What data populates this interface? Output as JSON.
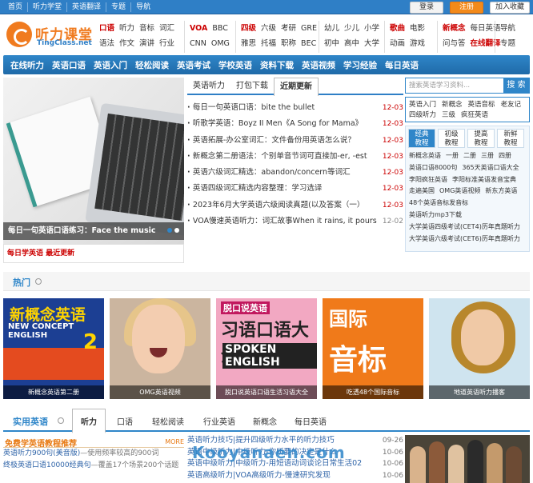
{
  "topbar": {
    "links": [
      "首页",
      "听力学堂",
      "英语翻译",
      "专题",
      "导航"
    ],
    "login": "登录",
    "register": "注册",
    "favorite": "加入收藏"
  },
  "logo": {
    "name": "听力课堂",
    "domain": "TingClass.net"
  },
  "quick": [
    {
      "rows": [
        [
          "口语",
          "听力",
          "音标",
          "词汇"
        ],
        [
          "语法",
          "作文",
          "演讲",
          "行业"
        ]
      ],
      "hl": [
        "口语"
      ]
    },
    {
      "rows": [
        [
          "VOA",
          "BBC"
        ],
        [
          "CNN",
          "OMG"
        ]
      ],
      "hl": [
        "VOA"
      ]
    },
    {
      "rows": [
        [
          "四级",
          "六级",
          "考研",
          "GRE"
        ],
        [
          "雅思",
          "托福",
          "职称",
          "BEC"
        ]
      ],
      "hl": [
        "四级"
      ]
    },
    {
      "rows": [
        [
          "幼儿",
          "少儿",
          "小学"
        ],
        [
          "初中",
          "高中",
          "大学"
        ]
      ],
      "hl": []
    },
    {
      "rows": [
        [
          "歌曲",
          "电影"
        ],
        [
          "动画",
          "游戏"
        ]
      ],
      "hl": [
        "歌曲"
      ]
    },
    {
      "rows": [
        [
          "新概念",
          "每日英语"
        ],
        [
          "问与答",
          "在线翻译"
        ]
      ],
      "hl": [
        "新概念",
        "在线翻译"
      ]
    },
    {
      "rows": [
        [
          "导航"
        ],
        [
          "专题"
        ]
      ],
      "hl": []
    }
  ],
  "mainnav": [
    "在线听力",
    "英语口语",
    "英语入门",
    "轻松阅读",
    "英语考试",
    "学校英语",
    "资料下载",
    "英语视频",
    "学习经验",
    "每日英语"
  ],
  "hero": {
    "caption": "每日一句英语口语练习：Face the music",
    "under": "每日学英语 最近更新"
  },
  "news": {
    "tabs": [
      "英语听力",
      "打包下载",
      "近期更新"
    ],
    "active_tab": "近期更新",
    "items": [
      {
        "title": "每日一句英语口语：bite the bullet",
        "date": "12-03"
      },
      {
        "title": "听歌学英语：Boyz II Men《A Song for Mama》",
        "date": "12-03"
      },
      {
        "title": "英语拓展-办公室词汇：文件备份用英语怎么说？",
        "date": "12-03"
      },
      {
        "title": "新概念第二册语法：个别单音节词可直接加-er, -est",
        "date": "12-03"
      },
      {
        "title": "英语六级词汇精选：abandon/concern等词汇",
        "date": "12-03"
      },
      {
        "title": "英语四级词汇精选内容整理：学习选译",
        "date": "12-03"
      },
      {
        "title": "2023年6月大学英语六级阅读真题(以及答案（一）",
        "date": "12-03"
      },
      {
        "title": "VOA慢速英语听力：词汇故事When it rains, it pours",
        "date": "12-02"
      }
    ]
  },
  "search": {
    "placeholder": "搜索英语学习资料...",
    "button": "搜 索"
  },
  "tags": [
    "英语入门",
    "新概念",
    "英语音标",
    "老友记",
    "四级听力",
    "三级",
    "疯狂英语"
  ],
  "course": {
    "tabs": [
      "经典\n教程",
      "初级\n教程",
      "提高\n教程",
      "新鲜\n教程"
    ],
    "rows": [
      [
        "新概念英语",
        "一册",
        "二册",
        "三册",
        "四册"
      ],
      [
        "英语口语8000句",
        "365天英语口语大全"
      ],
      [
        "李阳疯狂英语",
        "李阳标准美语发音宝典"
      ],
      [
        "走遍美国",
        "OMG英语视频",
        "新东方英语"
      ],
      [
        "48个英语音标发音标"
      ],
      [
        "英语听力mp3下载"
      ],
      [
        "大学英语四级考试(CET4)历年真题听力"
      ],
      [
        "大学英语六级考试(CET6)历年真题听力"
      ]
    ]
  },
  "hot": {
    "title": "热门",
    "thumbs": [
      {
        "caption": "新概念英语第二册",
        "big": "新概念英语",
        "sub": "NEW CONCEPT ENGLISH",
        "num": "2"
      },
      {
        "caption": "OMG英语视频"
      },
      {
        "caption": "脱口说英语口语生活习语大全",
        "l1": "脱口说英语",
        "l2": "习语口语大全",
        "l3": "SPOKEN ENGLISH"
      },
      {
        "caption": "吃透48个国际音标",
        "l1": "国际",
        "l2": "音标"
      },
      {
        "caption": "地道英语听力播客"
      }
    ]
  },
  "section2": {
    "title": "实用英语",
    "tabs": [
      "听力",
      "口语",
      "轻松阅读",
      "行业英语",
      "新概念",
      "每日英语"
    ],
    "active": "听力"
  },
  "free": {
    "title": "免费学英语教程推荐",
    "more": "MORE",
    "items": [
      {
        "t": "英语听力900句(美音版)",
        "d": "—使用频率较高的900词"
      },
      {
        "t": "终极英语口语10000经典句",
        "d": "—覆盖17个场景200个话题"
      },
      {
        "t": "",
        "d": ""
      }
    ]
  },
  "list2": [
    {
      "title": "英语听力技巧|提升四级听力水平的听力技巧",
      "date": "09-26"
    },
    {
      "title": "英语中级听力|中级听力-你所要的决定是什么",
      "date": "10-06"
    },
    {
      "title": "英语中级听力|中级听力-用短语动词谈论日常生活02",
      "date": "10-06"
    },
    {
      "title": "英语高级听力|VOA高级听力-慢速研究发现",
      "date": "10-06"
    }
  ],
  "watermark": "Kooyanaen.com"
}
